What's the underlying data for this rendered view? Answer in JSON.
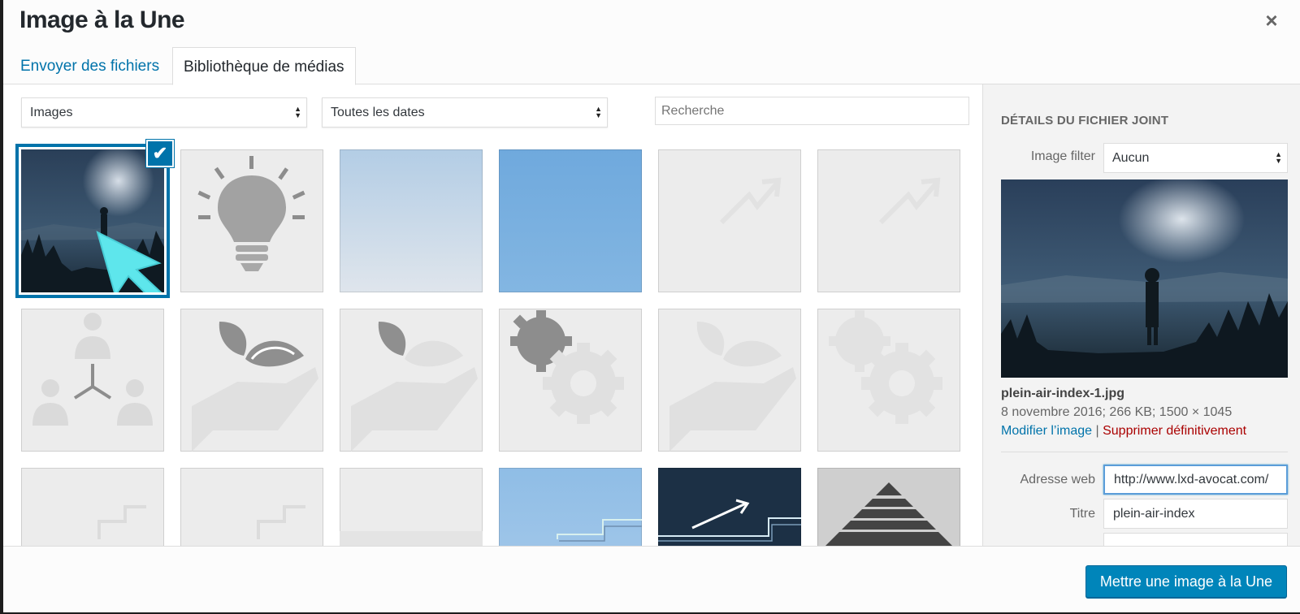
{
  "modal": {
    "title": "Image à la Une",
    "close_label": "×"
  },
  "tabs": [
    {
      "label": "Envoyer des fichiers",
      "active": false
    },
    {
      "label": "Bibliothèque de médias",
      "active": true
    }
  ],
  "toolbar": {
    "type_filter": "Images",
    "date_filter": "Toutes les dates",
    "search_placeholder": "Recherche"
  },
  "grid": {
    "items": [
      {
        "kind": "photo-mountain",
        "selected": true
      },
      {
        "kind": "lightbulb-icon"
      },
      {
        "kind": "gradient-light-blue"
      },
      {
        "kind": "solid-blue"
      },
      {
        "kind": "trend-arrow-icon"
      },
      {
        "kind": "trend-arrow-icon"
      },
      {
        "kind": "team-structure-icon"
      },
      {
        "kind": "hand-leaf-icon"
      },
      {
        "kind": "hand-leaf-icon"
      },
      {
        "kind": "gears-icon"
      },
      {
        "kind": "hand-leaf-icon"
      },
      {
        "kind": "gears-icon"
      },
      {
        "kind": "stairs-icon"
      },
      {
        "kind": "stairs-icon"
      },
      {
        "kind": "stairs-icon"
      },
      {
        "kind": "stairs-blue"
      },
      {
        "kind": "dark-arrow-stairs"
      },
      {
        "kind": "word-cloud-house"
      }
    ],
    "check_icon": "checkmark-icon",
    "selection_color": "#0073aa"
  },
  "sidebar": {
    "heading": "Détails du fichier joint",
    "filter_label": "Image filter",
    "filter_value": "Aucun",
    "filename": "plein-air-index-1.jpg",
    "meta": "8 novembre 2016;  266 KB;  1500 × 1045",
    "edit_link": "Modifier l’image",
    "separator": "|",
    "delete_link": "Supprimer définitivement",
    "url_label": "Adresse web",
    "url_value": "http://www.lxd-avocat.com/",
    "title_label": "Titre",
    "title_value": "plein-air-index"
  },
  "footer": {
    "primary_button": "Mettre une image à la Une",
    "primary_color": "#0085ba"
  }
}
